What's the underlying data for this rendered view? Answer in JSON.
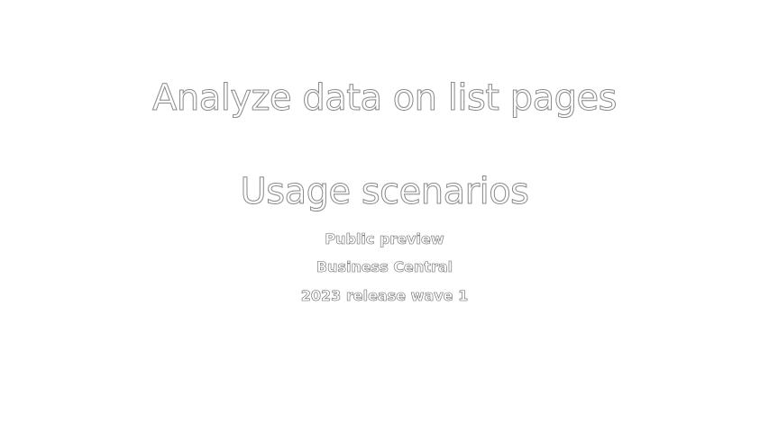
{
  "slide": {
    "title": "Analyze data on list pages",
    "subtitle": "Usage scenarios",
    "meta": [
      "Public preview",
      "Business Central",
      "2023 release wave 1"
    ]
  },
  "colors": {
    "background": "#ffffff",
    "text_fill": "#ffffff",
    "text_outline": "#8a8a8a"
  }
}
